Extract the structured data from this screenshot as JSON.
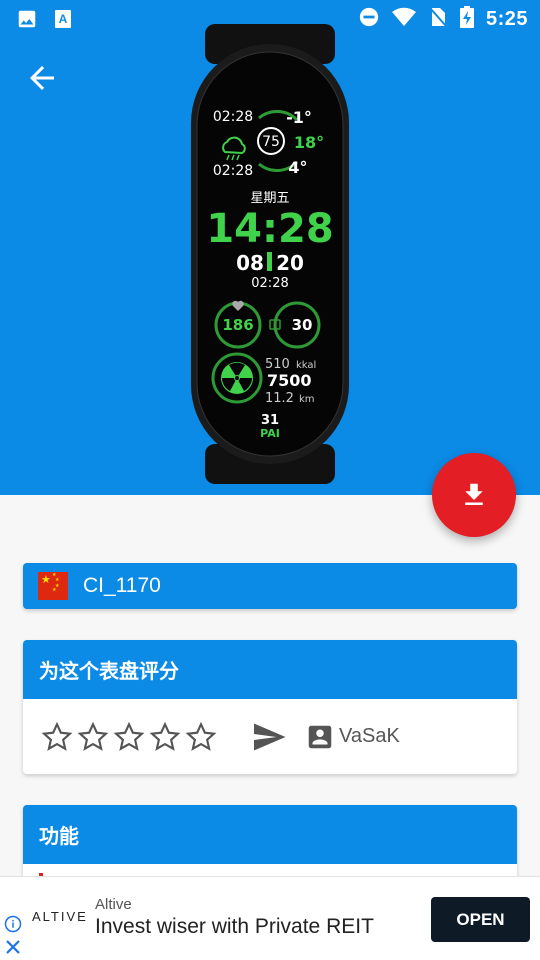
{
  "status_bar": {
    "time": "5:25",
    "icons": [
      "image-icon",
      "a-icon",
      "dnd-icon",
      "wifi-icon",
      "no-sim-icon",
      "battery-charging-icon"
    ]
  },
  "header": {
    "back_icon": "arrow-back-icon",
    "background_color": "#0b8ae6"
  },
  "watch_face": {
    "time_top": "02:28",
    "time_bottom": "02:28",
    "temp_low": "-1°",
    "temp_current": "18°",
    "temp_high": "4°",
    "aqi": "75",
    "weekday": "星期五",
    "clock": "14:28",
    "date_month": "08",
    "date_day": "20",
    "alarm": "02:28",
    "heart_rate": "186",
    "bt_value": "30",
    "calories": "510",
    "calories_unit": "kkal",
    "steps": "7500",
    "distance": "11.2",
    "distance_unit": "km",
    "pai_value": "31",
    "pai_label": "PAI"
  },
  "fab": {
    "icon": "download-icon",
    "color": "#e31e24"
  },
  "name_card": {
    "flag": "china-flag-icon",
    "title": "CI_1170"
  },
  "rate_card": {
    "title": "为这个表盘评分",
    "stars": 5,
    "rating": 0,
    "author": "VaSaK"
  },
  "features_card": {
    "title": "功能"
  },
  "ad": {
    "logo": "ALTIVE",
    "brand": "Altive",
    "headline": "Invest wiser with Private REIT",
    "button": "OPEN"
  }
}
